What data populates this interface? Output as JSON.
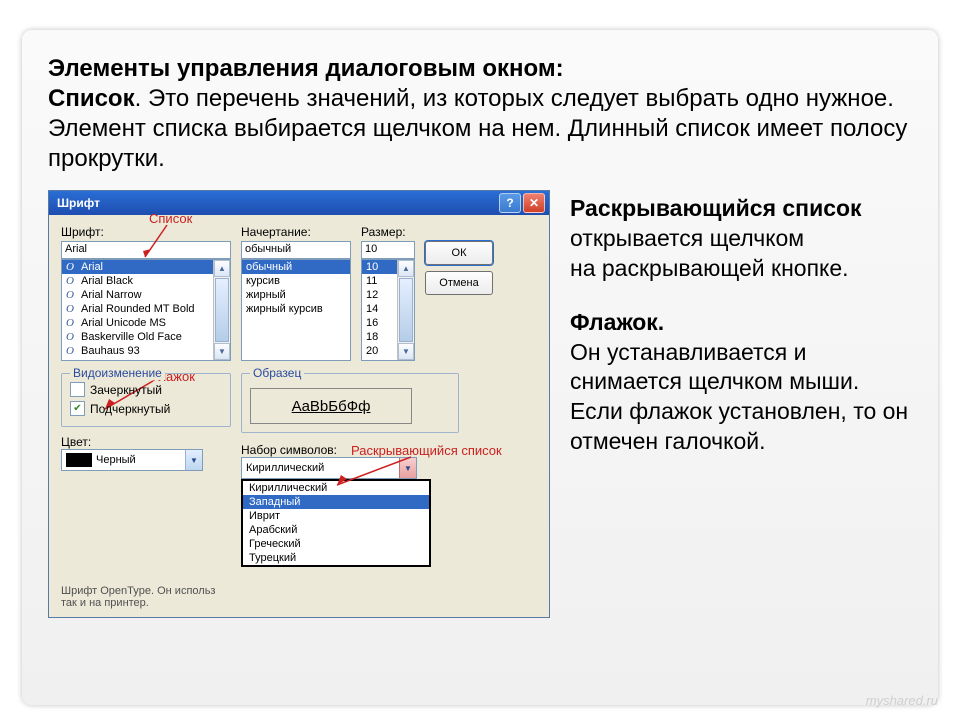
{
  "main_text": {
    "l1_bold": "Элементы управления диалоговым окном:",
    "l2_bold": "Список",
    "l2_rest": ". Это перечень значений, из которых следует выбрать одно нужное. Элемент списка выбирается щелчком на нем. Длинный список имеет полосу прокрутки."
  },
  "side_text": {
    "p1_bold": "Раскрывающийся список",
    "p1_rest": " открывается щелчком",
    "p1_l3": " на раскрывающей кнопке.",
    "p2_bold": "Флажок.",
    "p2_rest": "Он устанавливается и снимается щелчком мыши. Если флажок установлен, то он отмечен галочкой."
  },
  "dialog": {
    "title": "Шрифт",
    "font_label": "Шрифт:",
    "font_value": "Arial",
    "fonts": [
      "Arial",
      "Arial Black",
      "Arial Narrow",
      "Arial Rounded MT Bold",
      "Arial Unicode MS",
      "Baskerville Old Face",
      "Bauhaus 93"
    ],
    "style_label": "Начертание:",
    "style_value": "обычный",
    "styles": [
      "обычный",
      "курсив",
      "жирный",
      "жирный курсив"
    ],
    "size_label": "Размер:",
    "size_value": "10",
    "sizes": [
      "10",
      "11",
      "12",
      "14",
      "16",
      "18",
      "20"
    ],
    "ok": "ОК",
    "cancel": "Отмена",
    "mod_group": "Видоизменение",
    "strike": "Зачеркнутый",
    "underline": "Подчеркнутый",
    "sample_group": "Образец",
    "sample_text": "AaBbБбФф",
    "color_label": "Цвет:",
    "color_value": "Черный",
    "charset_label": "Набор символов:",
    "charset_value": "Кириллический",
    "charset_items": [
      "Кириллический",
      "Западный",
      "Иврит",
      "Арабский",
      "Греческий",
      "Турецкий"
    ],
    "hint": "Шрифт OpenType. Он используется как на экране, так и на принтер."
  },
  "annotations": {
    "list": "Список",
    "flag": "Флажок",
    "dropdown": "Раскрывающийся список"
  },
  "watermark": "myshared.ru"
}
